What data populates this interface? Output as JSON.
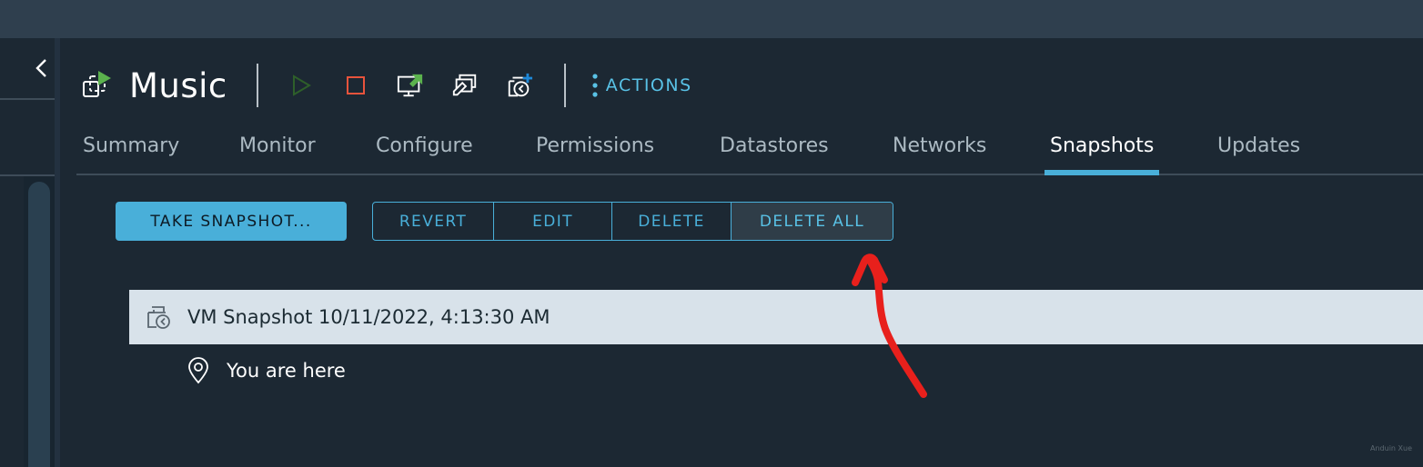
{
  "vm": {
    "name": "Music",
    "icon": "vm-powered-on-icon"
  },
  "toolbar": {
    "buttons": [
      {
        "name": "power-on",
        "icon": "play-icon",
        "enabled": false
      },
      {
        "name": "power-off",
        "icon": "stop-icon",
        "enabled": true
      },
      {
        "name": "launch-console",
        "icon": "launch-console-icon",
        "enabled": true
      },
      {
        "name": "edit-settings",
        "icon": "edit-settings-icon",
        "enabled": true
      },
      {
        "name": "take-snapshot",
        "icon": "snapshot-add-icon",
        "enabled": true
      }
    ],
    "actions_label": "ACTIONS"
  },
  "tabs": [
    {
      "label": "Summary",
      "active": false
    },
    {
      "label": "Monitor",
      "active": false
    },
    {
      "label": "Configure",
      "active": false
    },
    {
      "label": "Permissions",
      "active": false
    },
    {
      "label": "Datastores",
      "active": false
    },
    {
      "label": "Networks",
      "active": false
    },
    {
      "label": "Snapshots",
      "active": true
    },
    {
      "label": "Updates",
      "active": false
    }
  ],
  "snapshot_actions": {
    "take_label": "TAKE SNAPSHOT...",
    "group": [
      {
        "label": "REVERT"
      },
      {
        "label": "EDIT"
      },
      {
        "label": "DELETE"
      },
      {
        "label": "DELETE ALL"
      }
    ]
  },
  "snapshot_tree": {
    "snapshot_label": "VM Snapshot 10/11/2022, 4:13:30 AM",
    "current_label": "You are here"
  },
  "annotation": {
    "arrow_color": "#e8201c",
    "target": "DELETE ALL"
  },
  "watermark": "Anduin Xue",
  "colors": {
    "accent": "#49afd9",
    "background": "#1c2833",
    "topbar": "#2f3f4e",
    "stop_red": "#e8533c",
    "play_green": "#2e5f2a",
    "running_green": "#5bb24d",
    "snapshot_row": "#d8e2ea"
  }
}
